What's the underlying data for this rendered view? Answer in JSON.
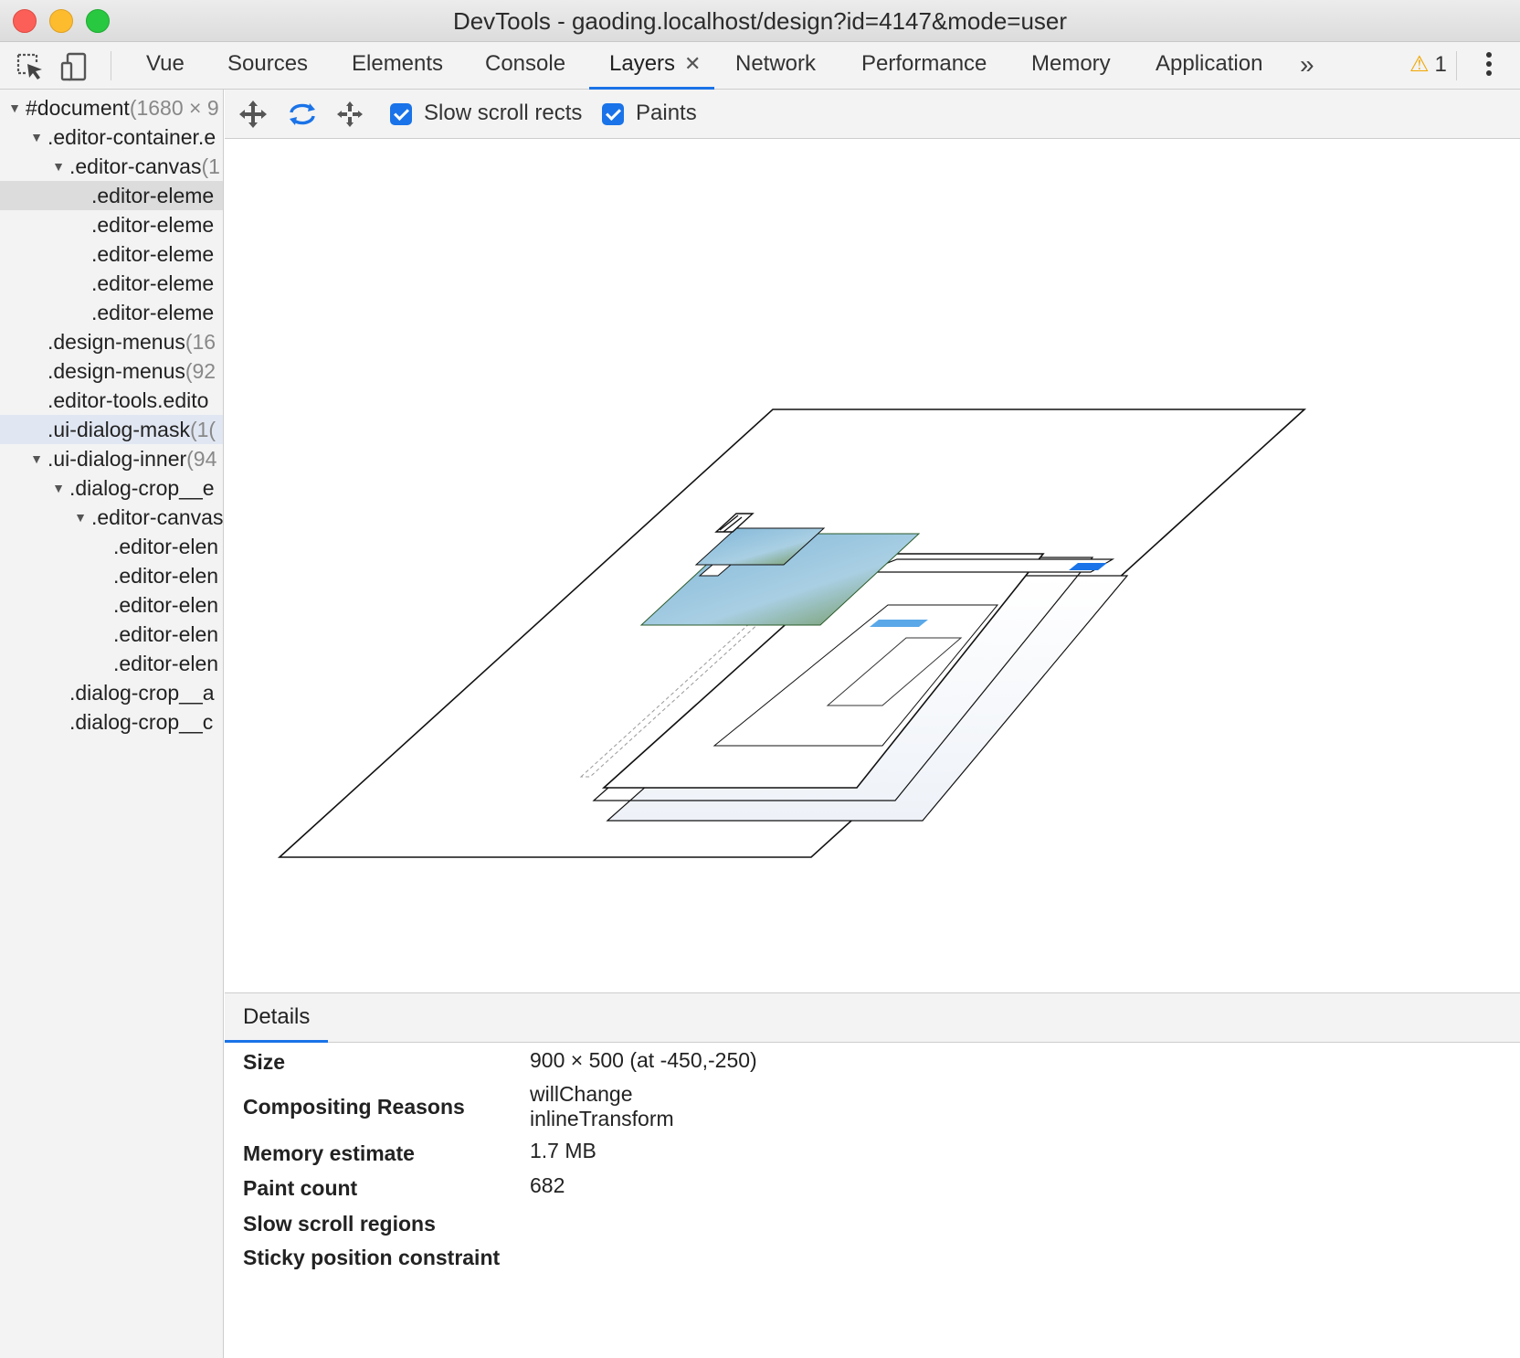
{
  "window": {
    "title": "DevTools - gaoding.localhost/design?id=4147&mode=user"
  },
  "toolbar": {
    "tabs": [
      {
        "label": "Vue"
      },
      {
        "label": "Sources"
      },
      {
        "label": "Elements"
      },
      {
        "label": "Console"
      },
      {
        "label": "Layers",
        "close": "✕"
      },
      {
        "label": "Network"
      },
      {
        "label": "Performance"
      },
      {
        "label": "Memory"
      },
      {
        "label": "Application"
      }
    ],
    "more": "»",
    "warning_count": "1"
  },
  "tree": {
    "nodes": [
      {
        "toggle": "▼",
        "name": "#document",
        "dim": "(1680 × 9"
      },
      {
        "toggle": "▼",
        "name": ".editor-container.e",
        "dim": ""
      },
      {
        "toggle": "▼",
        "name": ".editor-canvas",
        "dim": "(1"
      },
      {
        "toggle": "",
        "name": ".editor-eleme",
        "dim": ""
      },
      {
        "toggle": "",
        "name": ".editor-eleme",
        "dim": ""
      },
      {
        "toggle": "",
        "name": ".editor-eleme",
        "dim": ""
      },
      {
        "toggle": "",
        "name": ".editor-eleme",
        "dim": ""
      },
      {
        "toggle": "",
        "name": ".editor-eleme",
        "dim": ""
      },
      {
        "toggle": "",
        "name": ".design-menus",
        "dim": "(16"
      },
      {
        "toggle": "",
        "name": ".design-menus",
        "dim": "(92"
      },
      {
        "toggle": "",
        "name": ".editor-tools.edito",
        "dim": ""
      },
      {
        "toggle": "",
        "name": ".ui-dialog-mask",
        "dim": "(1("
      },
      {
        "toggle": "▼",
        "name": ".ui-dialog-inner",
        "dim": "(94"
      },
      {
        "toggle": "▼",
        "name": ".dialog-crop__e",
        "dim": ""
      },
      {
        "toggle": "▼",
        "name": ".editor-canvas",
        "dim": ""
      },
      {
        "toggle": "",
        "name": ".editor-elen",
        "dim": ""
      },
      {
        "toggle": "",
        "name": ".editor-elen",
        "dim": ""
      },
      {
        "toggle": "",
        "name": ".editor-elen",
        "dim": ""
      },
      {
        "toggle": "",
        "name": ".editor-elen",
        "dim": ""
      },
      {
        "toggle": "",
        "name": ".editor-elen",
        "dim": ""
      },
      {
        "toggle": "",
        "name": ".dialog-crop__a",
        "dim": ""
      },
      {
        "toggle": "",
        "name": ".dialog-crop__c",
        "dim": ""
      }
    ]
  },
  "layers_toolbar": {
    "slow_scroll_rects": {
      "label": "Slow scroll rects",
      "checked": true
    },
    "paints": {
      "label": "Paints",
      "checked": true
    }
  },
  "details": {
    "tab": "Details",
    "rows": [
      {
        "key": "Size",
        "value": "900 × 500 (at -450,-250)"
      },
      {
        "key": "Compositing Reasons",
        "value": "willChange",
        "value2": "inlineTransform"
      },
      {
        "key": "Memory estimate",
        "value": "1.7 MB"
      },
      {
        "key": "Paint count",
        "value": "682"
      },
      {
        "key": "Slow scroll regions",
        "value": ""
      },
      {
        "key": "Sticky position constraint",
        "value": ""
      }
    ]
  },
  "colors": {
    "accent": "#1a73e8",
    "warning": "#f2a600"
  }
}
